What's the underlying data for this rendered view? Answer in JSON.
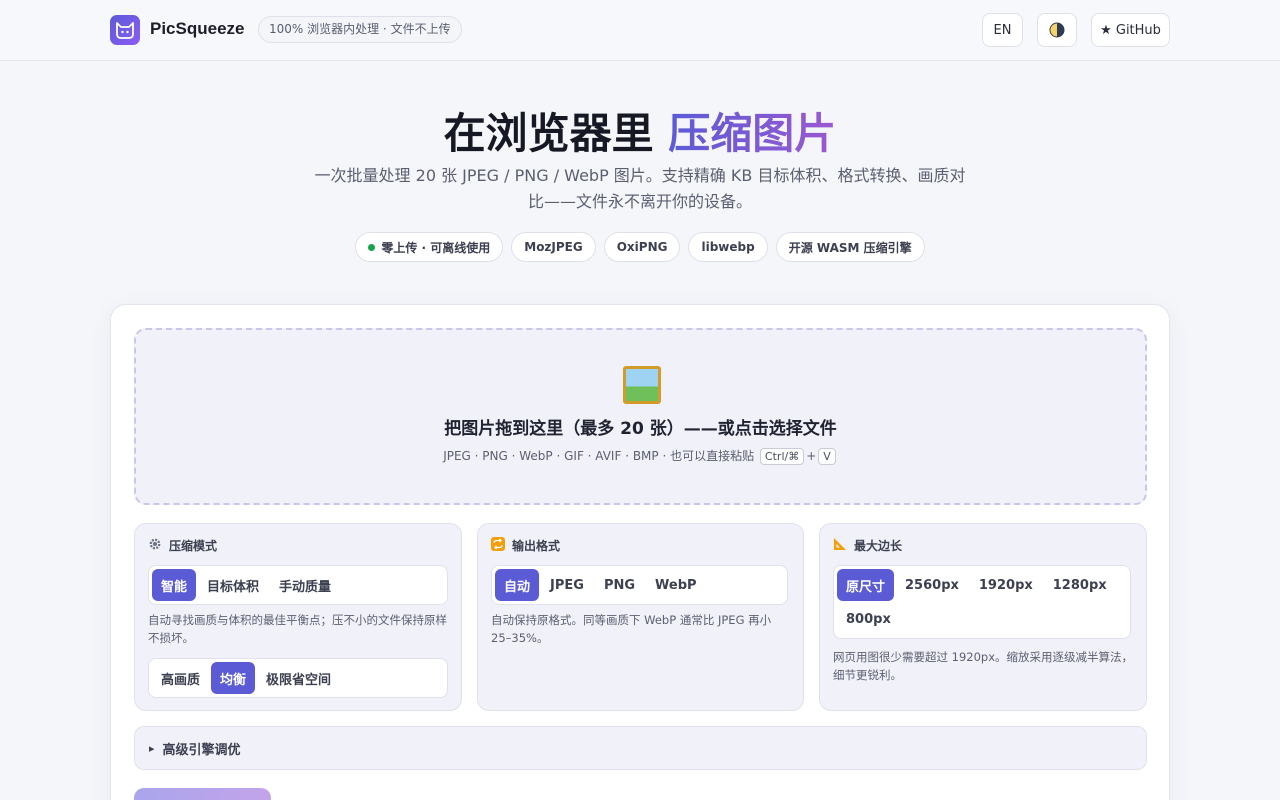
{
  "header": {
    "brand": "PicSqueeze",
    "privacy_pill": "100% 浏览器内处理 · 文件不上传",
    "lang_button": "EN",
    "github_button": "★ GitHub",
    "icons": {
      "logo": "cat-logo-icon",
      "theme": "half-moon-theme-icon"
    }
  },
  "hero": {
    "title_prefix": "在浏览器里 ",
    "title_accent": "压缩图片",
    "subtitle": "一次批量处理 20 张 JPEG / PNG / WebP 图片。支持精确 KB 目标体积、格式转换、画质对比——文件永不离开你的设备。",
    "tags": [
      {
        "label": "零上传 · 可离线使用",
        "dot_color": "#16a34a"
      },
      {
        "label": "MozJPEG"
      },
      {
        "label": "OxiPNG"
      },
      {
        "label": "libwebp"
      },
      {
        "label": "开源 WASM 压缩引擎"
      }
    ]
  },
  "dropzone": {
    "icon": "framed-picture-icon",
    "title": "把图片拖到这里（最多 20 张）——或点击选择文件",
    "hint_prefix": "JPEG · PNG · WebP · GIF · AVIF · BMP · 也可以直接粘贴",
    "kbd_mod": "Ctrl/⌘",
    "kbd_plus": "+",
    "kbd_key": "V"
  },
  "panels": {
    "mode": {
      "icon": "gear-icon",
      "title": "压缩模式",
      "options": [
        "智能",
        "目标体积",
        "手动质量"
      ],
      "selected": "智能",
      "note": "自动寻找画质与体积的最佳平衡点；压不小的文件保持原样不损坏。",
      "levels": [
        "高画质",
        "均衡",
        "极限省空间"
      ],
      "selected_level": "均衡"
    },
    "format": {
      "icon": "repeat-arrows-icon",
      "title": "输出格式",
      "options": [
        "自动",
        "JPEG",
        "PNG",
        "WebP"
      ],
      "selected": "自动",
      "note": "自动保持原格式。同等画质下 WebP 通常比 JPEG 再小 25–35%。"
    },
    "size": {
      "icon": "triangle-ruler-icon",
      "title": "最大边长",
      "options": [
        "原尺寸",
        "2560px",
        "1920px",
        "1280px",
        "800px"
      ],
      "selected": "原尺寸",
      "note": "网页用图很少需要超过 1920px。缩放采用逐级减半算法，细节更锐利。"
    }
  },
  "advanced": {
    "arrow": "▸",
    "label": "高级引擎调优"
  },
  "colors": {
    "accent": "#5b5bd6",
    "accent_gradient_end": "#9b59d0"
  }
}
